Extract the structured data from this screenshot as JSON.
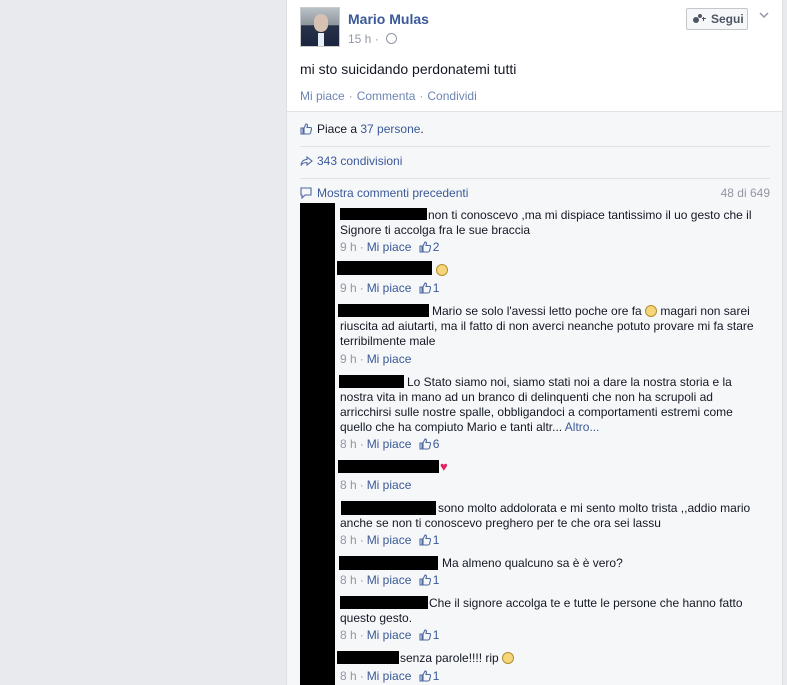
{
  "post": {
    "author": "Mario Mulas",
    "time": "15 h",
    "follow_label": "Segui",
    "text": "mi sto suicidando perdonatemi tutti",
    "actions": [
      "Mi piace",
      "Commenta",
      "Condividi"
    ],
    "likes_prefix": "Piace a",
    "likes_link": "37 persone",
    "likes_suffix": ".",
    "shares": "343 condivisioni",
    "more_comments": "Mostra commenti precedenti",
    "comment_count": "48 di 649"
  },
  "comments": [
    {
      "text": "non ti conoscevo ,ma mi dispiace tantissimo il uo gesto che il Signore ti accolga fra le sue braccia",
      "time": "9 h",
      "like": "Mi piace",
      "likes": "2"
    },
    {
      "text": "",
      "time": "9 h",
      "like": "Mi piace",
      "likes": "1",
      "emoji": "smile-icon"
    },
    {
      "text": "Mario se solo l'avessi letto poche ore fa",
      "text2": "magari non sarei riuscita ad aiutarti, ma il fatto di non averci neanche potuto provare mi fa stare terribilmente male",
      "time": "9 h",
      "like": "Mi piace",
      "emoji": "smile-icon"
    },
    {
      "text": "Lo Stato siamo noi, siamo stati noi a dare la nostra storia e la nostra vita in mano ad un branco di delinquenti che non ha scrupoli ad arricchirsi sulle nostre spalle, obbligandoci a comportamenti estremi come quello che ha compiuto Mario e tanti altr...",
      "more": "Altro...",
      "time": "8 h",
      "like": "Mi piace",
      "likes": "6"
    },
    {
      "text": "",
      "time": "8 h",
      "like": "Mi piace",
      "emoji": "heart-icon"
    },
    {
      "text": "sono molto addolorata e mi sento molto trista ,,addio mario anche se non ti conoscevo preghero per te che ora sei lassu",
      "time": "8 h",
      "like": "Mi piace",
      "likes": "1"
    },
    {
      "text": "Ma almeno qualcuno sa è è vero?",
      "time": "8 h",
      "like": "Mi piace",
      "likes": "1"
    },
    {
      "text": "Che il signore accolga te e tutte le persone che hanno fatto questo gesto.",
      "time": "8 h",
      "like": "Mi piace",
      "likes": "1"
    },
    {
      "text": "senza parole!!!! rip",
      "time": "8 h",
      "like": "Mi piace",
      "likes": "1",
      "emoji": "sad-icon"
    }
  ]
}
